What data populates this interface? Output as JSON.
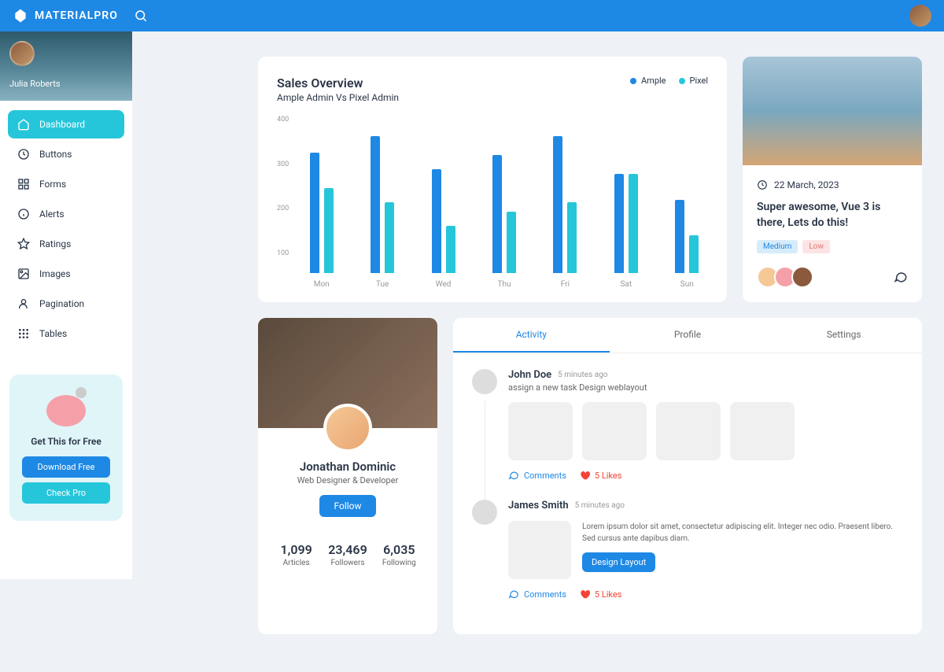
{
  "brand": "MATERIALPRO",
  "user": {
    "name": "Julia Roberts"
  },
  "nav": [
    {
      "label": "Dashboard",
      "icon": "home",
      "active": true
    },
    {
      "label": "Buttons",
      "icon": "clock"
    },
    {
      "label": "Forms",
      "icon": "grid"
    },
    {
      "label": "Alerts",
      "icon": "info"
    },
    {
      "label": "Ratings",
      "icon": "star"
    },
    {
      "label": "Images",
      "icon": "image"
    },
    {
      "label": "Pagination",
      "icon": "user"
    },
    {
      "label": "Tables",
      "icon": "apps"
    }
  ],
  "promo": {
    "title": "Get This for Free",
    "btn1": "Download Free",
    "btn2": "Check Pro"
  },
  "chart": {
    "title": "Sales Overview",
    "subtitle": "Ample Admin Vs Pixel Admin",
    "legend": [
      "Ample",
      "Pixel"
    ]
  },
  "chart_data": {
    "type": "bar",
    "title": "Sales Overview",
    "categories": [
      "Mon",
      "Tue",
      "Wed",
      "Thu",
      "Fri",
      "Sat",
      "Sun"
    ],
    "series": [
      {
        "name": "Ample",
        "values": [
          355,
          390,
          320,
          350,
          390,
          310,
          255
        ]
      },
      {
        "name": "Pixel",
        "values": [
          280,
          250,
          200,
          230,
          250,
          310,
          180
        ]
      }
    ],
    "ylabel": "",
    "xlabel": "",
    "ylim": [
      100,
      400
    ],
    "yticks": [
      100,
      200,
      300,
      400
    ]
  },
  "blog": {
    "date": "22 March, 2023",
    "title": "Super awesome, Vue 3 is there, Lets do this!",
    "tags": [
      {
        "label": "Medium",
        "cls": "med"
      },
      {
        "label": "Low",
        "cls": "low"
      }
    ]
  },
  "profile": {
    "name": "Jonathan Dominic",
    "role": "Web Designer & Developer",
    "follow": "Follow",
    "stats": [
      {
        "val": "1,099",
        "label": "Articles"
      },
      {
        "val": "23,469",
        "label": "Followers"
      },
      {
        "val": "6,035",
        "label": "Following"
      }
    ]
  },
  "activity": {
    "tabs": [
      "Activity",
      "Profile",
      "Settings"
    ],
    "items": [
      {
        "name": "John Doe",
        "time": "5 minutes ago",
        "text": "assign a new task Design weblayout",
        "images": 4,
        "comments": "Comments",
        "likes": "5 Likes"
      },
      {
        "name": "James Smith",
        "time": "5 minutes ago",
        "desc": "Lorem ipsum dolor sit amet, consectetur adipiscing elit. Integer nec odio. Praesent libero. Sed cursus ante dapibus diam.",
        "btn": "Design Layout",
        "comments": "Comments",
        "likes": "5 Likes"
      }
    ]
  }
}
